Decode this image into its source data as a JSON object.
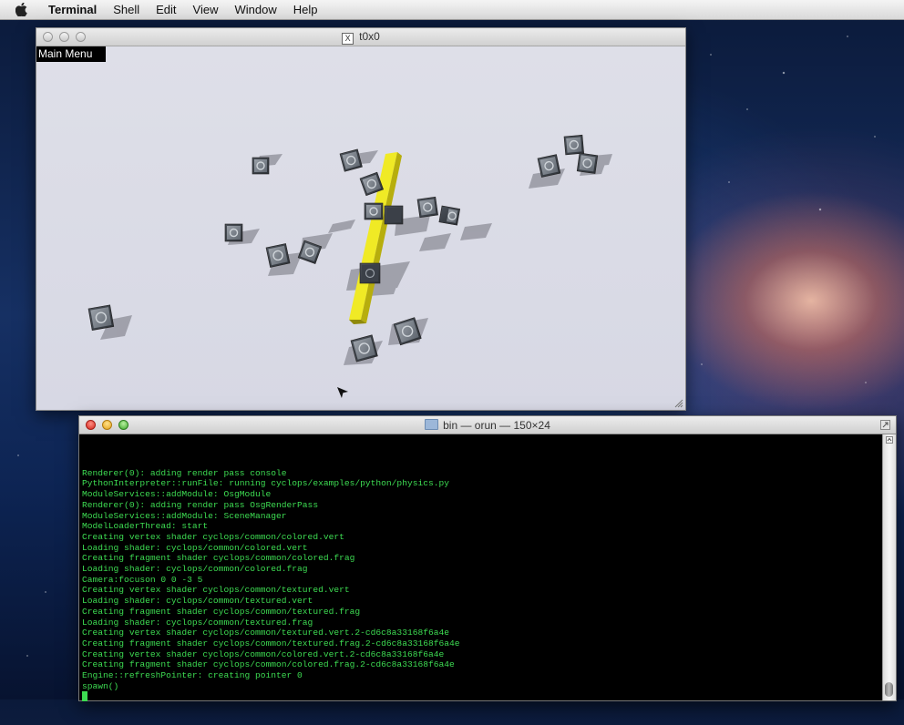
{
  "menubar": {
    "items": [
      "Terminal",
      "Shell",
      "Edit",
      "View",
      "Window",
      "Help"
    ]
  },
  "x11_window": {
    "title": "t0x0",
    "main_menu_label": "Main Menu"
  },
  "terminal": {
    "title": "bin — orun — 150×24",
    "lines": [
      "Renderer(0): adding render pass console",
      "PythonInterpreter::runFile: running cyclops/examples/python/physics.py",
      "ModuleServices::addModule: OsgModule",
      "Renderer(0): adding render pass OsgRenderPass",
      "ModuleServices::addModule: SceneManager",
      "ModelLoaderThread: start",
      "Creating vertex shader cyclops/common/colored.vert",
      "Loading shader: cyclops/common/colored.vert",
      "Creating fragment shader cyclops/common/colored.frag",
      "Loading shader: cyclops/common/colored.frag",
      "Camera:focuson 0 0 -3 5",
      "Creating vertex shader cyclops/common/textured.vert",
      "Loading shader: cyclops/common/textured.vert",
      "Creating fragment shader cyclops/common/textured.frag",
      "Loading shader: cyclops/common/textured.frag",
      "Creating vertex shader cyclops/common/textured.vert.2-cd6c8a33168f6a4e",
      "Creating fragment shader cyclops/common/textured.frag.2-cd6c8a33168f6a4e",
      "Creating vertex shader cyclops/common/colored.vert.2-cd6c8a33168f6a4e",
      "Creating fragment shader cyclops/common/colored.frag.2-cd6c8a33168f6a4e",
      "Engine::refreshPointer: creating pointer 0",
      "spawn()"
    ]
  },
  "colors": {
    "terminal_text": "#3ddc52",
    "beam": "#e3e01a",
    "scene_bg": "#d9dae4"
  },
  "icons": [
    "apple-icon",
    "x11-icon",
    "folder-icon",
    "zoom-icon",
    "mouse-pointer-icon",
    "resize-grip-icon"
  ]
}
